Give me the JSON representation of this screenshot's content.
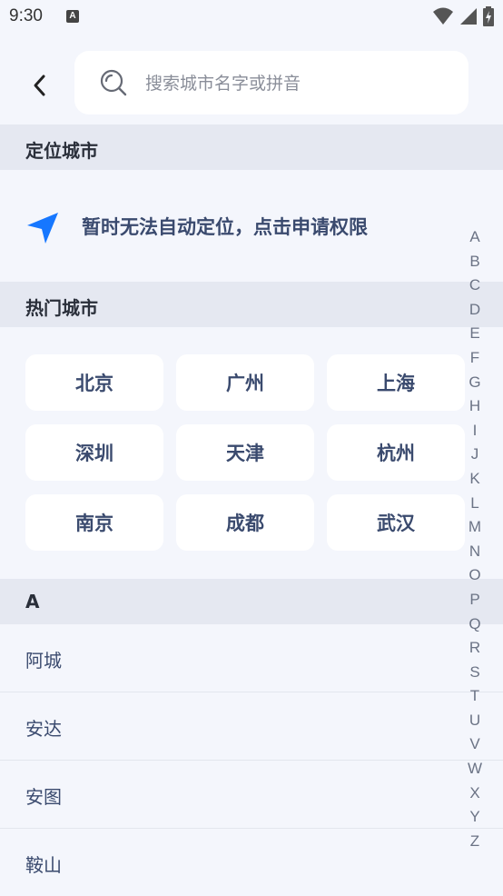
{
  "status_bar": {
    "time": "9:30",
    "a_label": "A",
    "icons": [
      "notification-a-icon",
      "wifi-icon",
      "signal-icon",
      "battery-icon"
    ]
  },
  "header": {
    "back_icon": "chevron-left-icon",
    "search_icon": "search-icon",
    "search_placeholder": "搜索城市名字或拼音",
    "search_value": ""
  },
  "location_section": {
    "title": "定位城市",
    "icon": "navigation-arrow-icon",
    "message": "暂时无法自动定位，点击申请权限"
  },
  "hot_section": {
    "title": "热门城市",
    "cities": [
      "北京",
      "广州",
      "上海",
      "深圳",
      "天津",
      "杭州",
      "南京",
      "成都",
      "武汉"
    ]
  },
  "list_section": {
    "letter": "A",
    "cities": [
      "阿城",
      "安达",
      "安图",
      "鞍山"
    ]
  },
  "index_bar": {
    "letters": [
      "A",
      "B",
      "C",
      "D",
      "E",
      "F",
      "G",
      "H",
      "I",
      "J",
      "K",
      "L",
      "M",
      "N",
      "O",
      "P",
      "Q",
      "R",
      "S",
      "T",
      "U",
      "V",
      "W",
      "X",
      "Y",
      "Z"
    ]
  },
  "colors": {
    "background": "#f4f6fc",
    "section_header": "#e5e8f1",
    "accent": "#1677ff",
    "text_primary": "#3a4a6e"
  }
}
